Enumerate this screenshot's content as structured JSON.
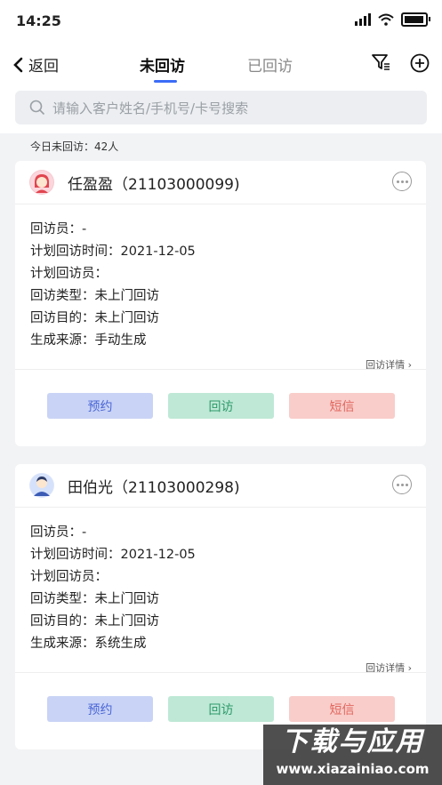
{
  "status": {
    "time": "14:25"
  },
  "nav": {
    "back": "返回",
    "tab_pending": "未回访",
    "tab_done": "已回访"
  },
  "search": {
    "placeholder": "请输入客户姓名/手机号/卡号搜索"
  },
  "count": {
    "text": "今日未回访：42人"
  },
  "cards": [
    {
      "name": "任盈盈（21103000099)",
      "lines": [
        "回访员：-",
        "计划回访时间：2021-12-05",
        "计划回访员：",
        "回访类型：未上门回访",
        "回访目的：未上门回访",
        "生成来源：手动生成"
      ],
      "detail": "回访详情 ›",
      "btn_reserve": "预约",
      "btn_visit": "回访",
      "btn_sms": "短信"
    },
    {
      "name": "田伯光（21103000298)",
      "lines": [
        "回访员：-",
        "计划回访时间：2021-12-05",
        "计划回访员：",
        "回访类型：未上门回访",
        "回访目的：未上门回访",
        "生成来源：系统生成"
      ],
      "detail": "回访详情 ›",
      "btn_reserve": "预约",
      "btn_visit": "回访",
      "btn_sms": "短信"
    }
  ],
  "watermark": {
    "line1": "下载与应用",
    "line2": "www.xiazainiao.com"
  }
}
